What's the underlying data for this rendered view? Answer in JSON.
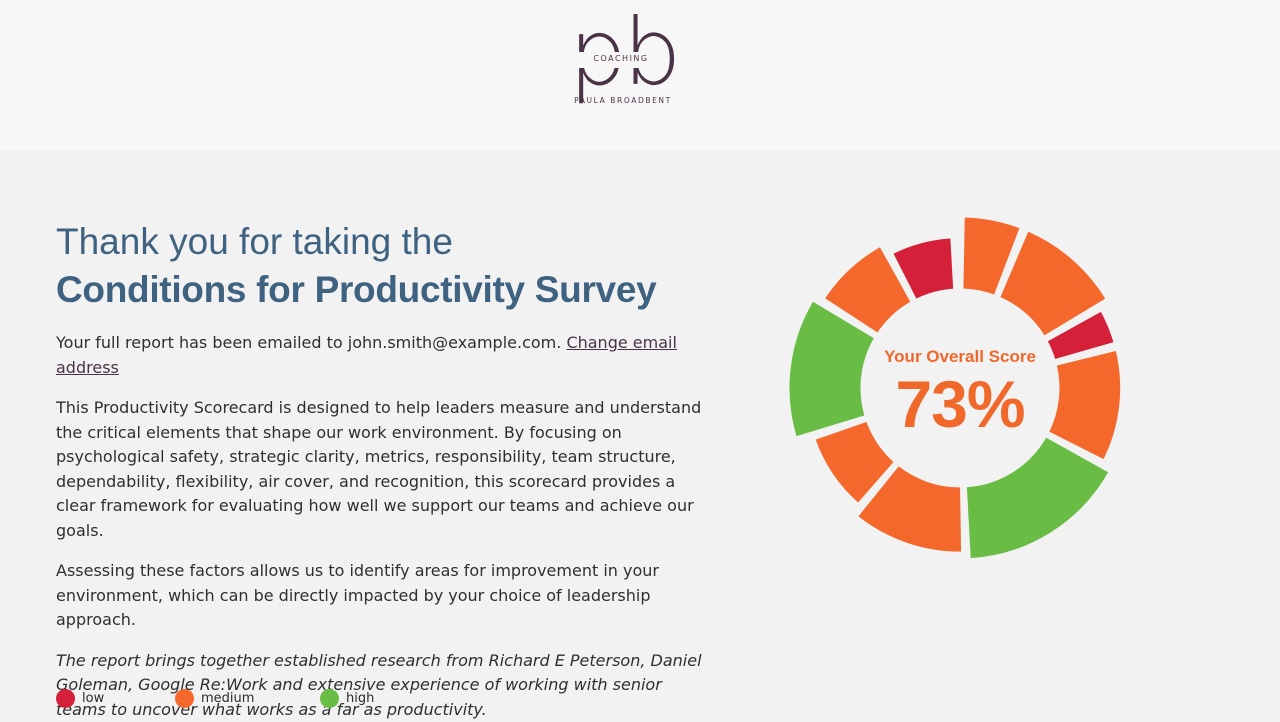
{
  "brand": {
    "logo_letters": "pb",
    "logo_subtitle": "COACHING",
    "logo_name": "PAULA BROADBENT"
  },
  "intro": {
    "title_line1": "Thank you for taking the",
    "title_line2": "Conditions for Productivity Survey",
    "email_text": "Your full report has been emailed to john.smith@example.com.",
    "change_email_link": "Change email address",
    "paragraph1": "This Productivity Scorecard is designed to help leaders measure and understand the critical elements that shape our work environment. By focusing on psychological safety, strategic clarity, metrics, responsibility, team structure, dependability, flexibility, air cover, and recognition, this scorecard provides a clear framework for evaluating how well we support our teams and achieve our goals.",
    "paragraph2": "Assessing these factors allows us to identify areas for improvement in your environment, which can be directly impacted by your choice of leadership approach.",
    "paragraph3": "The report brings together established research from Richard E Peterson, Daniel Goleman, Google Re:Work and extensive experience of working with senior teams to uncover what works as a far as productivity."
  },
  "legend": [
    {
      "label": "low",
      "color": "#d42039"
    },
    {
      "label": "medium",
      "color": "#f4682b"
    },
    {
      "label": "high",
      "color": "#69bd45"
    }
  ],
  "score": {
    "label": "Your Overall Score",
    "value": "73%"
  },
  "colors": {
    "low": "#d42039",
    "medium": "#f4682b",
    "high": "#69bd45",
    "title": "#3e6280",
    "brand": "#4a3347"
  },
  "chart_data": {
    "type": "pie",
    "style": "radial-segments",
    "segments": [
      {
        "angle_start": 0,
        "angle_end": 22,
        "level": "medium",
        "outer": 1.0
      },
      {
        "angle_start": 22,
        "angle_end": 60,
        "level": "medium",
        "outer": 1.0
      },
      {
        "angle_start": 60,
        "angle_end": 75,
        "level": "low",
        "outer": 0.94
      },
      {
        "angle_start": 75,
        "angle_end": 118,
        "level": "medium",
        "outer": 0.94
      },
      {
        "angle_start": 118,
        "angle_end": 178,
        "level": "high",
        "outer": 1.0
      },
      {
        "angle_start": 178,
        "angle_end": 220,
        "level": "medium",
        "outer": 0.96
      },
      {
        "angle_start": 220,
        "angle_end": 252,
        "level": "medium",
        "outer": 0.9
      },
      {
        "angle_start": 252,
        "angle_end": 302,
        "level": "high",
        "outer": 1.0
      },
      {
        "angle_start": 302,
        "angle_end": 332,
        "level": "medium",
        "outer": 0.95
      },
      {
        "angle_start": 332,
        "angle_end": 358,
        "level": "low",
        "outer": 0.88
      }
    ]
  }
}
